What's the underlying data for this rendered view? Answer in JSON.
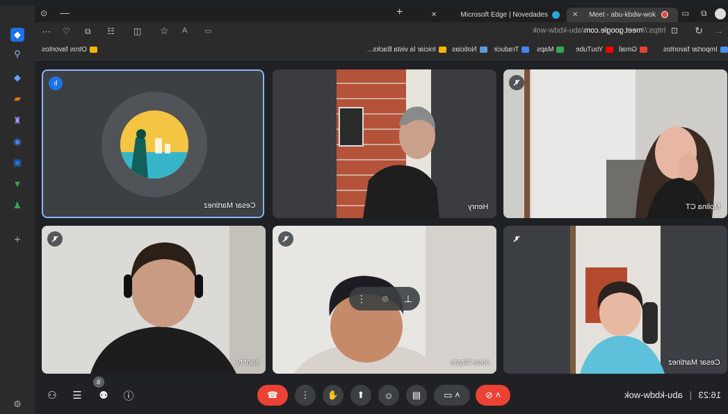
{
  "browser": {
    "tabs": [
      {
        "label": "Meet - abu-kbdw-wok",
        "active": true
      },
      {
        "label": "Microsoft Edge | Novedades",
        "active": false
      }
    ],
    "address": {
      "scheme": "https://",
      "host": "meet.google.com",
      "path": "/abu-kbdw-wok"
    },
    "favorites": [
      {
        "label": "Importar favoritos",
        "color": "#4c8bf5"
      },
      {
        "label": "Gmail",
        "color": "#ea4335"
      },
      {
        "label": "YouTube",
        "color": "#ff0000"
      },
      {
        "label": "Maps",
        "color": "#34a853"
      },
      {
        "label": "Traducir",
        "color": "#4285f4"
      },
      {
        "label": "Noticias",
        "color": "#5e9bd6"
      },
      {
        "label": "Iniciar la vista Backs...",
        "color": "#f4b400"
      }
    ],
    "other_favorites": "Otros favoritos"
  },
  "meeting": {
    "code": "abu-kbdw-wok",
    "time": "16:23",
    "separator": "|",
    "people_count": "6",
    "participants": [
      {
        "name": "Cesar Martinez",
        "kind": "avatar",
        "speaking": true
      },
      {
        "name": "Henry",
        "kind": "video"
      },
      {
        "name": "Molina CT",
        "kind": "video",
        "muted": true
      },
      {
        "name": "sant tv",
        "kind": "video",
        "muted": true
      },
      {
        "name": "Jose Alzate",
        "kind": "video",
        "muted": true
      },
      {
        "name": "Cesar Martinez",
        "kind": "video",
        "muted": true
      }
    ]
  },
  "colors": {
    "end_call": "#ea4335",
    "mic_off": "#ea4335",
    "speaking_border": "#8ab4f8",
    "avatar_bg": "#f4b400"
  }
}
